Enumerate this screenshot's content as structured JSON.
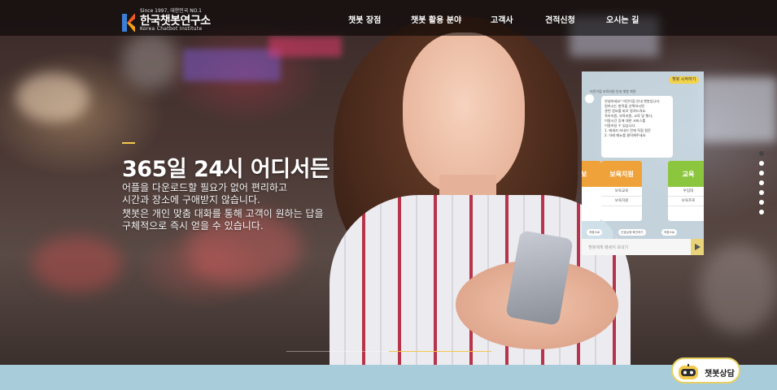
{
  "header": {
    "logo": {
      "since": "Since 1997, 대한민국 NO.1",
      "name": "한국챗봇연구소",
      "english": "Korea Chatbot Institute"
    },
    "nav": [
      {
        "label": "챗봇 장점"
      },
      {
        "label": "챗봇 활용 분야"
      },
      {
        "label": "고객사"
      },
      {
        "label": "견적신청"
      },
      {
        "label": "오시는 길"
      }
    ]
  },
  "hero": {
    "headline": "365일 24시 어디서든",
    "lines": [
      "어플을 다운로드할 필요가 없어 편리하고",
      "시간과 장소에 구애받지 않습니다.",
      "챗봇은 개인 맞춤 대화를 통해 고객이 원하는 답을",
      "구체적으로 즉시 얻을 수 있습니다."
    ],
    "progress": 0.5
  },
  "chat_preview": {
    "badge": "챗봇 시작하기",
    "title": "어린이집 보육지원 안내 챗봇 화면",
    "bubble_lines": [
      "안녕하세요! 어린이집 안내 챗봇입니다.",
      "원하시는 항목을 선택하시면",
      "관련 정보를 바로 알려드려요.",
      "",
      "육아지원, 보육지원, 교육 및 행사,",
      "이용시간 등에 대한 서비스를",
      "이용하실 수 있습니다.",
      "",
      "1. 메세지 보내기 란에 직접 질문",
      "2. 아래 메뉴를 클릭해주세요."
    ],
    "cards": [
      {
        "title": "정보",
        "color": "#f0a23a",
        "rows": [
          "",
          "",
          ""
        ]
      },
      {
        "title": "보육지원",
        "color": "#f0a23a",
        "rows": [
          "보육교육",
          "보육지원",
          ""
        ]
      },
      {
        "title": "교육",
        "color": "#8cc63f",
        "rows": [
          "투입대",
          "보육프로",
          ""
        ]
      }
    ],
    "chips": [
      "처음으로",
      "선생님께 확인하기",
      "처음으로"
    ],
    "input_placeholder": "챗봇에게 메세지 보내기"
  },
  "slider": {
    "count": 7,
    "active_index": 0
  },
  "chatbot_button": {
    "label": "챗봇상담"
  },
  "colors": {
    "accent": "#f2c94c",
    "footer_band": "#a9ccdb",
    "topbar": "#000000"
  }
}
